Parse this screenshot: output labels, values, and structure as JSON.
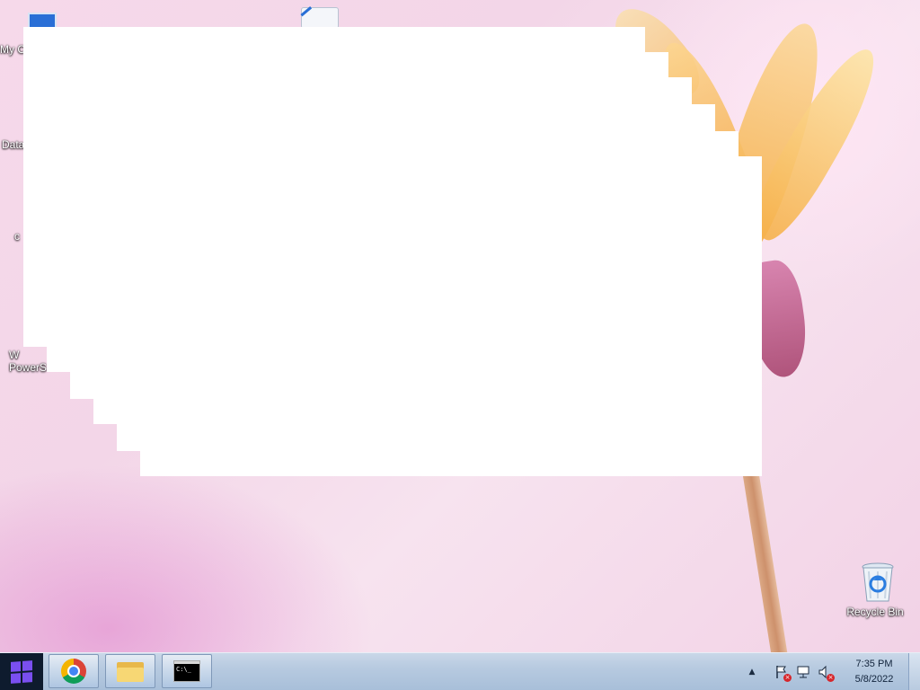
{
  "desktop": {
    "icons": [
      {
        "label": "My C",
        "icon": "computer-icon"
      },
      {
        "label": "Data",
        "icon": "database-shortcut-icon"
      },
      {
        "label": "c",
        "icon": "chrome-shortcut-icon"
      },
      {
        "label": "W\nPowerS",
        "icon": "powershell-shortcut-icon"
      },
      {
        "label": "",
        "icon": "document-icon"
      },
      {
        "label": "Recycle Bin",
        "icon": "recycle-bin-icon"
      }
    ]
  },
  "taskbar": {
    "start_icon": "windows-logo-icon",
    "pinned": [
      {
        "name": "Google Chrome",
        "icon": "chrome-icon"
      },
      {
        "name": "File Explorer",
        "icon": "folder-icon"
      },
      {
        "name": "Command Prompt",
        "icon": "cmd-icon"
      }
    ],
    "cmd_glyph": "C:\\_",
    "tray": {
      "overflow_glyph": "▲",
      "icons": [
        "action-center-flag-icon",
        "network-icon",
        "volume-muted-icon"
      ],
      "time": "7:35 PM",
      "date": "5/8/2022"
    }
  },
  "colors": {
    "accent": "#7a4ff0",
    "taskbar": "#b7cae0",
    "start": "#0e1b2e",
    "error_badge": "#d6262b"
  }
}
